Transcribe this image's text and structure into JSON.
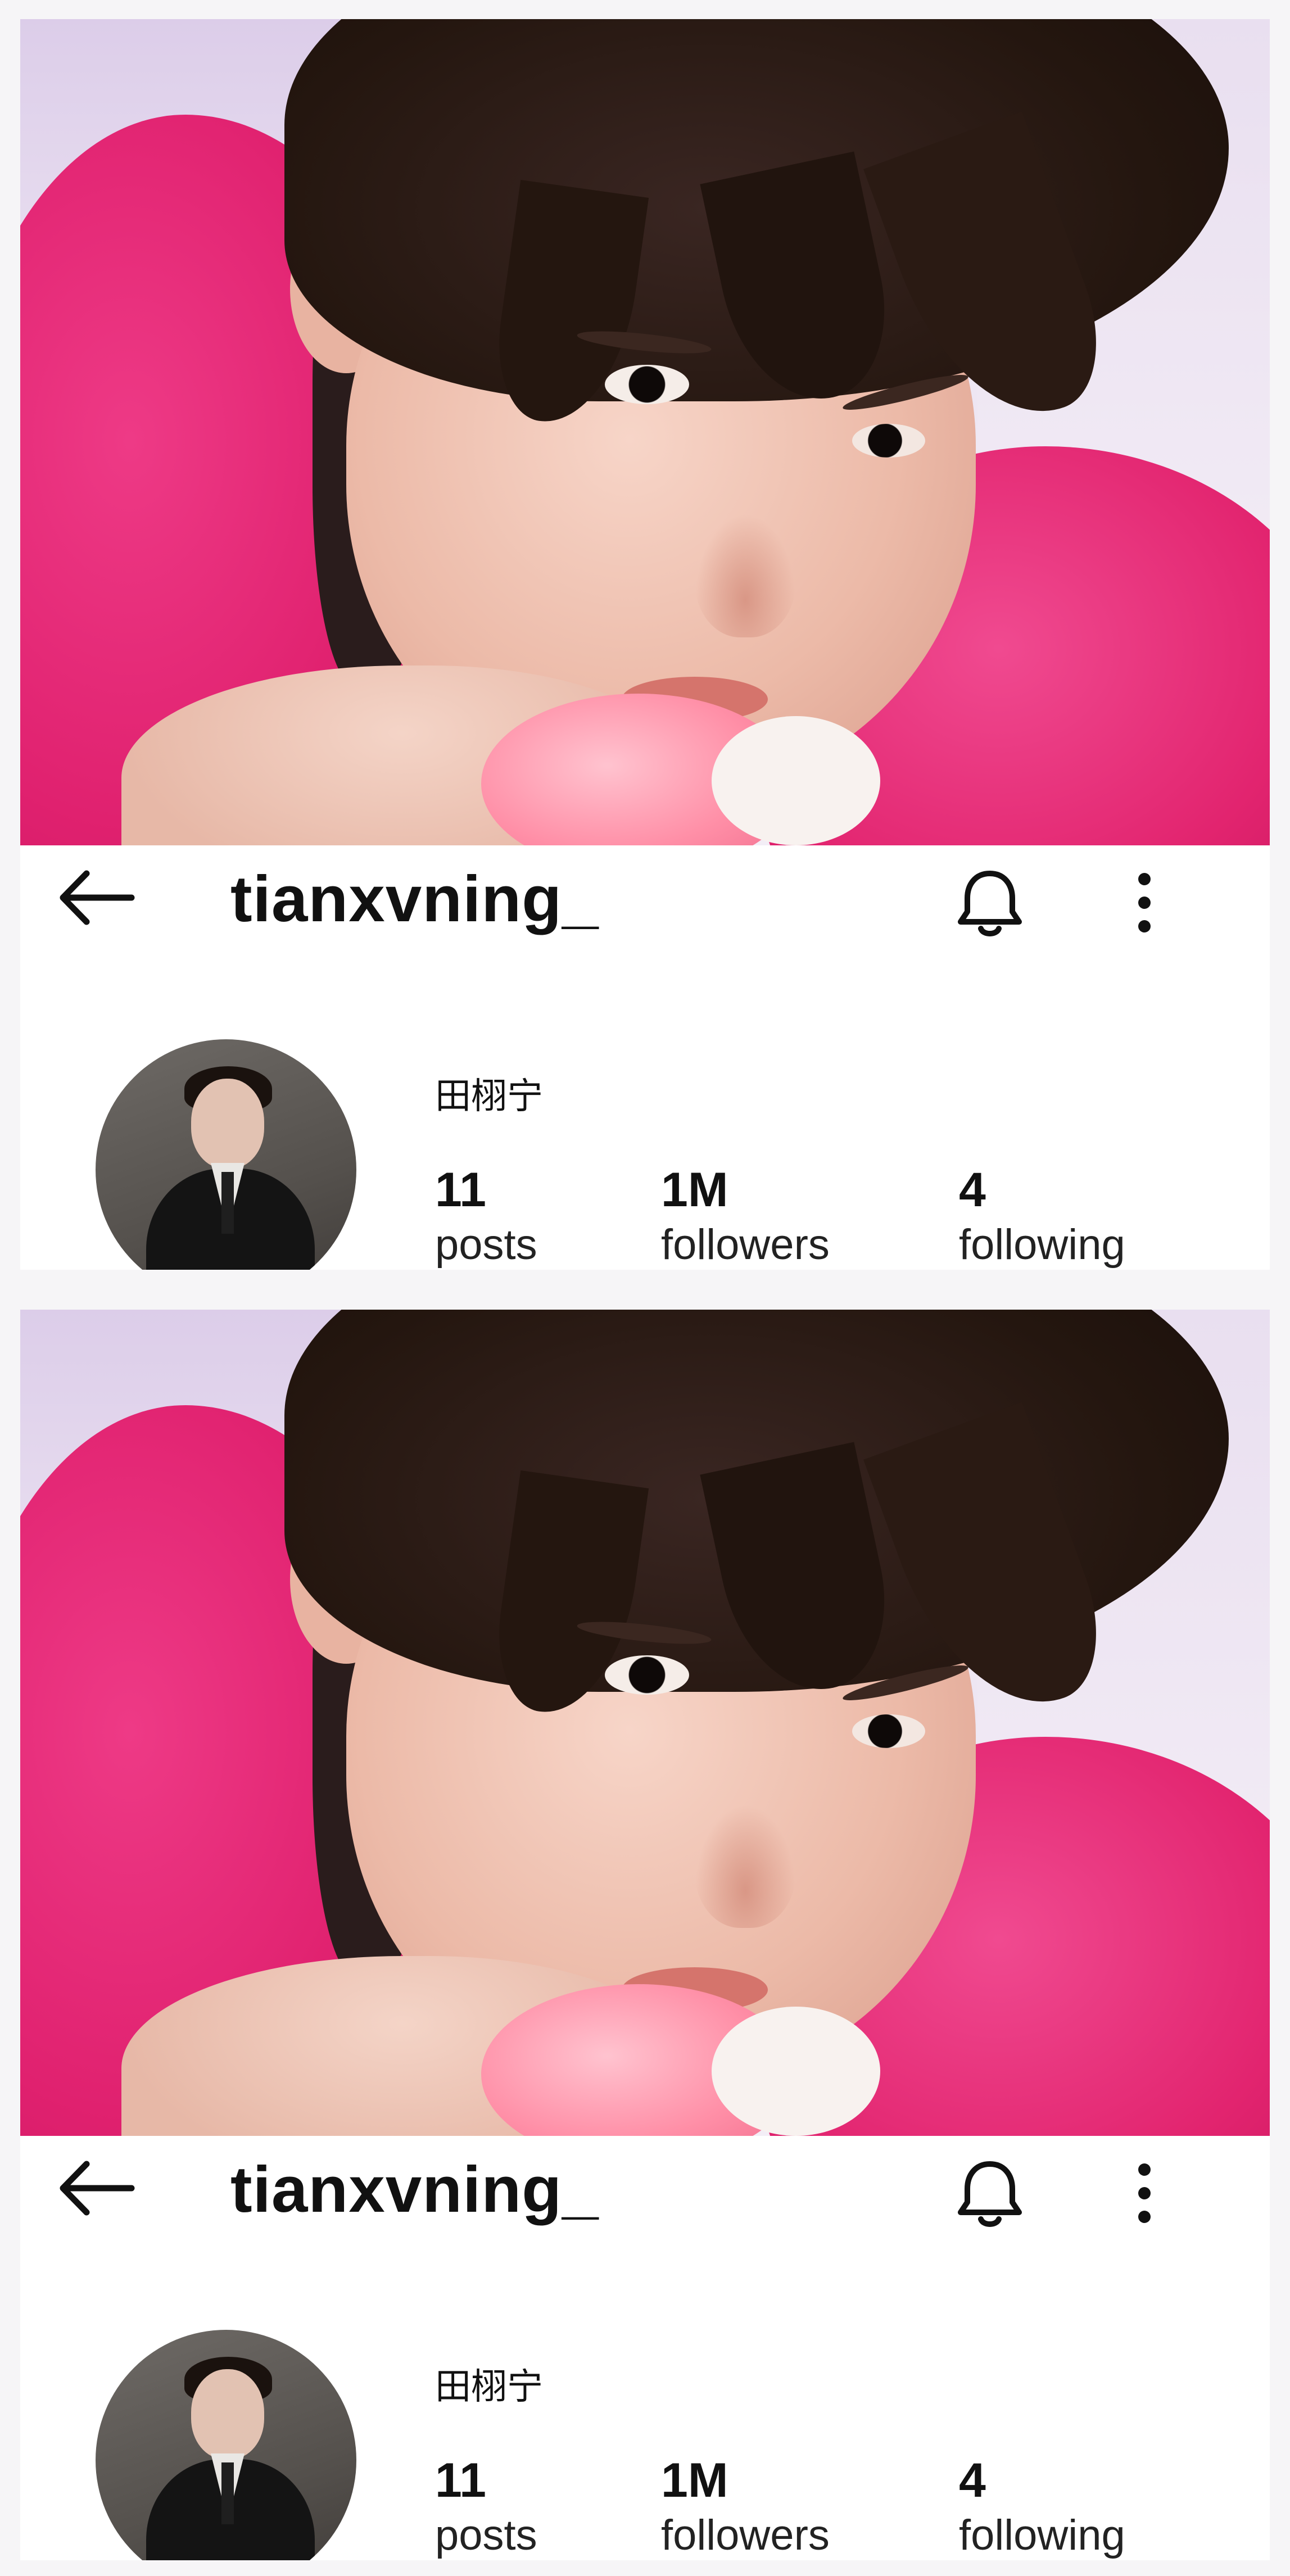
{
  "screens": [
    {
      "header": {
        "back_icon": "arrow-left-icon",
        "username": "tianxvning_",
        "bell_icon": "bell-icon",
        "more_icon": "more-vertical-icon"
      },
      "profile": {
        "display_name": "田栩宁",
        "stats": [
          {
            "value": "11",
            "label": "posts"
          },
          {
            "value": "1M",
            "label": "followers"
          },
          {
            "value": "4",
            "label": "following"
          }
        ]
      }
    },
    {
      "header": {
        "back_icon": "arrow-left-icon",
        "username": "tianxvning_",
        "bell_icon": "bell-icon",
        "more_icon": "more-vertical-icon"
      },
      "profile": {
        "display_name": "田栩宁",
        "stats": [
          {
            "value": "11",
            "label": "posts"
          },
          {
            "value": "1M",
            "label": "followers"
          },
          {
            "value": "4",
            "label": "following"
          }
        ]
      }
    }
  ],
  "colors": {
    "background": "#f6f5f7",
    "text": "#111111",
    "hoodie_pink": "#e0216f"
  }
}
